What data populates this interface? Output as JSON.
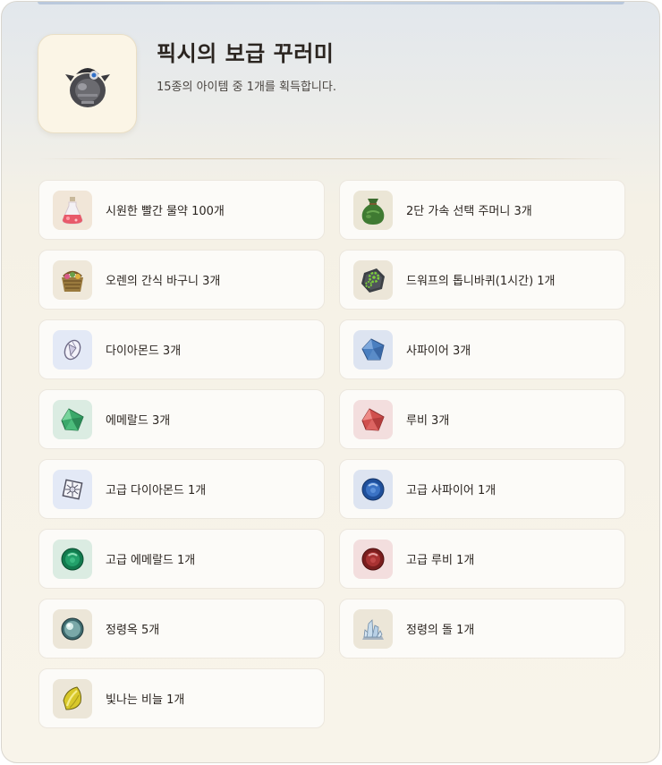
{
  "header": {
    "title": "픽시의 보급 꾸러미",
    "subtitle": "15종의 아이템 중 1개를 획득합니다.",
    "icon": "pixie-supply-pouch-icon"
  },
  "colors": {
    "background_top": "#e2e7ec",
    "background_bottom": "#f8f4ea",
    "text": "#2b2520",
    "card": "#fcfbf8"
  },
  "items": [
    {
      "name": "item-red-potion",
      "label": "시원한 빨간 물약 100개",
      "icon": "red-potion-icon",
      "bg": "#f1e6d8"
    },
    {
      "name": "item-speed-pouch",
      "label": "2단 가속 선택 주머니 3개",
      "icon": "green-pouch-icon",
      "bg": "#ebe6d6"
    },
    {
      "name": "item-snack-basket",
      "label": "오렌의 간식 바구니 3개",
      "icon": "snack-basket-icon",
      "bg": "#efe8da"
    },
    {
      "name": "item-dwarf-saw",
      "label": "드워프의 톱니바퀴(1시간) 1개",
      "icon": "gear-icon",
      "bg": "#ece6d8"
    },
    {
      "name": "item-diamond",
      "label": "다이아몬드 3개",
      "icon": "diamond-icon",
      "bg": "#e3e9f6"
    },
    {
      "name": "item-sapphire",
      "label": "사파이어 3개",
      "icon": "sapphire-icon",
      "bg": "#dde4f1"
    },
    {
      "name": "item-emerald",
      "label": "에메랄드 3개",
      "icon": "emerald-icon",
      "bg": "#dbece2"
    },
    {
      "name": "item-ruby",
      "label": "루비 3개",
      "icon": "ruby-icon",
      "bg": "#f3dede"
    },
    {
      "name": "item-high-diamond",
      "label": "고급 다이아몬드 1개",
      "icon": "high-diamond-icon",
      "bg": "#e3e9f6"
    },
    {
      "name": "item-high-sapphire",
      "label": "고급 사파이어 1개",
      "icon": "high-sapphire-icon",
      "bg": "#dde4f1"
    },
    {
      "name": "item-high-emerald",
      "label": "고급 에메랄드 1개",
      "icon": "high-emerald-icon",
      "bg": "#dbece2"
    },
    {
      "name": "item-high-ruby",
      "label": "고급 루비 1개",
      "icon": "high-ruby-icon",
      "bg": "#f3dede"
    },
    {
      "name": "item-spirit-orb",
      "label": "정령옥 5개",
      "icon": "spirit-orb-icon",
      "bg": "#ece6d8"
    },
    {
      "name": "item-spirit-stone",
      "label": "정령의 돌 1개",
      "icon": "spirit-stone-crystal-icon",
      "bg": "#ece6d8"
    },
    {
      "name": "item-glowing-scale",
      "label": "빛나는 비늘 1개",
      "icon": "glowing-scale-icon",
      "bg": "#ece6d8"
    }
  ]
}
